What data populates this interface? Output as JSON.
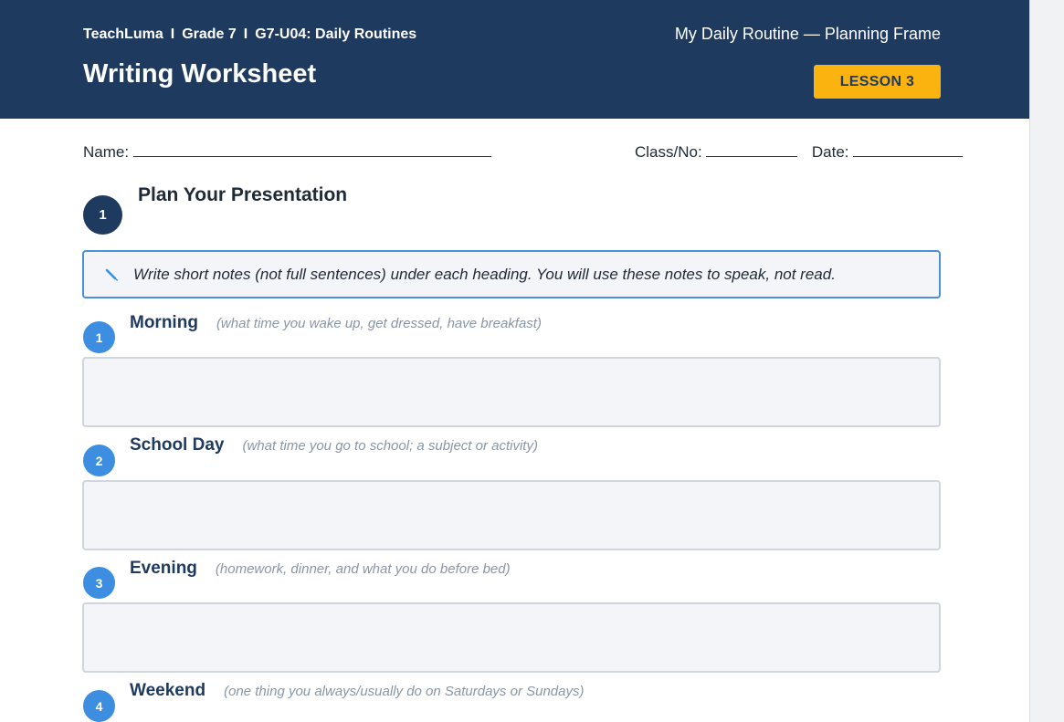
{
  "header": {
    "brand": "TeachLuma",
    "separator": "I",
    "grade": "Grade 7",
    "unit": "G7-U04: Daily Routines",
    "doc_title": "Writing Worksheet",
    "frame_title": "My Daily Routine — Planning Frame",
    "lesson_badge": "LESSON 3"
  },
  "fields": {
    "name_label": "Name:",
    "class_label": "Class/No:",
    "date_label": "Date:"
  },
  "section": {
    "number": "1",
    "title": "Plan Your Presentation"
  },
  "instructions": {
    "icon": "pencil-icon",
    "text": "Write short notes (not full sentences) under each heading. You will use these notes to speak, not read."
  },
  "items": [
    {
      "number": "1",
      "title": "Morning",
      "hint": "(what time you wake up, get dressed, have breakfast)"
    },
    {
      "number": "2",
      "title": "School Day",
      "hint": "(what time you go to school; a subject or activity)"
    },
    {
      "number": "3",
      "title": "Evening",
      "hint": "(homework, dinner, and what you do before bed)"
    },
    {
      "number": "4",
      "title": "Weekend",
      "hint": "(one thing you always/usually do on Saturdays or Sundays)"
    }
  ],
  "colors": {
    "header_bg": "#1f3a5f",
    "badge_bg": "#fbb40f",
    "accent_blue": "#3d8ee0",
    "box_bg": "#f3f5f8"
  }
}
